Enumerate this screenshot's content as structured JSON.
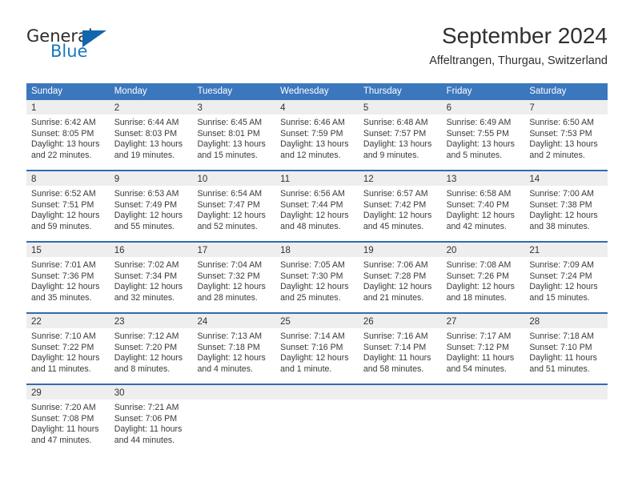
{
  "brand": {
    "name_top": "General",
    "name_bottom": "Blue",
    "color_top": "#2b2b2b",
    "color_bottom": "#1878be",
    "triangle_color": "#1266ab"
  },
  "header": {
    "title": "September 2024",
    "subtitle": "Affeltrangen, Thurgau, Switzerland"
  },
  "theme": {
    "header_blue": "#3b77bd",
    "separator_blue": "#2f6cb3",
    "day_band_gray": "#eeeeee",
    "text_color": "#333333"
  },
  "weekdays": [
    "Sunday",
    "Monday",
    "Tuesday",
    "Wednesday",
    "Thursday",
    "Friday",
    "Saturday"
  ],
  "weeks": [
    [
      {
        "day": "1",
        "sunrise": "Sunrise: 6:42 AM",
        "sunset": "Sunset: 8:05 PM",
        "daylight1": "Daylight: 13 hours",
        "daylight2": "and 22 minutes."
      },
      {
        "day": "2",
        "sunrise": "Sunrise: 6:44 AM",
        "sunset": "Sunset: 8:03 PM",
        "daylight1": "Daylight: 13 hours",
        "daylight2": "and 19 minutes."
      },
      {
        "day": "3",
        "sunrise": "Sunrise: 6:45 AM",
        "sunset": "Sunset: 8:01 PM",
        "daylight1": "Daylight: 13 hours",
        "daylight2": "and 15 minutes."
      },
      {
        "day": "4",
        "sunrise": "Sunrise: 6:46 AM",
        "sunset": "Sunset: 7:59 PM",
        "daylight1": "Daylight: 13 hours",
        "daylight2": "and 12 minutes."
      },
      {
        "day": "5",
        "sunrise": "Sunrise: 6:48 AM",
        "sunset": "Sunset: 7:57 PM",
        "daylight1": "Daylight: 13 hours",
        "daylight2": "and 9 minutes."
      },
      {
        "day": "6",
        "sunrise": "Sunrise: 6:49 AM",
        "sunset": "Sunset: 7:55 PM",
        "daylight1": "Daylight: 13 hours",
        "daylight2": "and 5 minutes."
      },
      {
        "day": "7",
        "sunrise": "Sunrise: 6:50 AM",
        "sunset": "Sunset: 7:53 PM",
        "daylight1": "Daylight: 13 hours",
        "daylight2": "and 2 minutes."
      }
    ],
    [
      {
        "day": "8",
        "sunrise": "Sunrise: 6:52 AM",
        "sunset": "Sunset: 7:51 PM",
        "daylight1": "Daylight: 12 hours",
        "daylight2": "and 59 minutes."
      },
      {
        "day": "9",
        "sunrise": "Sunrise: 6:53 AM",
        "sunset": "Sunset: 7:49 PM",
        "daylight1": "Daylight: 12 hours",
        "daylight2": "and 55 minutes."
      },
      {
        "day": "10",
        "sunrise": "Sunrise: 6:54 AM",
        "sunset": "Sunset: 7:47 PM",
        "daylight1": "Daylight: 12 hours",
        "daylight2": "and 52 minutes."
      },
      {
        "day": "11",
        "sunrise": "Sunrise: 6:56 AM",
        "sunset": "Sunset: 7:44 PM",
        "daylight1": "Daylight: 12 hours",
        "daylight2": "and 48 minutes."
      },
      {
        "day": "12",
        "sunrise": "Sunrise: 6:57 AM",
        "sunset": "Sunset: 7:42 PM",
        "daylight1": "Daylight: 12 hours",
        "daylight2": "and 45 minutes."
      },
      {
        "day": "13",
        "sunrise": "Sunrise: 6:58 AM",
        "sunset": "Sunset: 7:40 PM",
        "daylight1": "Daylight: 12 hours",
        "daylight2": "and 42 minutes."
      },
      {
        "day": "14",
        "sunrise": "Sunrise: 7:00 AM",
        "sunset": "Sunset: 7:38 PM",
        "daylight1": "Daylight: 12 hours",
        "daylight2": "and 38 minutes."
      }
    ],
    [
      {
        "day": "15",
        "sunrise": "Sunrise: 7:01 AM",
        "sunset": "Sunset: 7:36 PM",
        "daylight1": "Daylight: 12 hours",
        "daylight2": "and 35 minutes."
      },
      {
        "day": "16",
        "sunrise": "Sunrise: 7:02 AM",
        "sunset": "Sunset: 7:34 PM",
        "daylight1": "Daylight: 12 hours",
        "daylight2": "and 32 minutes."
      },
      {
        "day": "17",
        "sunrise": "Sunrise: 7:04 AM",
        "sunset": "Sunset: 7:32 PM",
        "daylight1": "Daylight: 12 hours",
        "daylight2": "and 28 minutes."
      },
      {
        "day": "18",
        "sunrise": "Sunrise: 7:05 AM",
        "sunset": "Sunset: 7:30 PM",
        "daylight1": "Daylight: 12 hours",
        "daylight2": "and 25 minutes."
      },
      {
        "day": "19",
        "sunrise": "Sunrise: 7:06 AM",
        "sunset": "Sunset: 7:28 PM",
        "daylight1": "Daylight: 12 hours",
        "daylight2": "and 21 minutes."
      },
      {
        "day": "20",
        "sunrise": "Sunrise: 7:08 AM",
        "sunset": "Sunset: 7:26 PM",
        "daylight1": "Daylight: 12 hours",
        "daylight2": "and 18 minutes."
      },
      {
        "day": "21",
        "sunrise": "Sunrise: 7:09 AM",
        "sunset": "Sunset: 7:24 PM",
        "daylight1": "Daylight: 12 hours",
        "daylight2": "and 15 minutes."
      }
    ],
    [
      {
        "day": "22",
        "sunrise": "Sunrise: 7:10 AM",
        "sunset": "Sunset: 7:22 PM",
        "daylight1": "Daylight: 12 hours",
        "daylight2": "and 11 minutes."
      },
      {
        "day": "23",
        "sunrise": "Sunrise: 7:12 AM",
        "sunset": "Sunset: 7:20 PM",
        "daylight1": "Daylight: 12 hours",
        "daylight2": "and 8 minutes."
      },
      {
        "day": "24",
        "sunrise": "Sunrise: 7:13 AM",
        "sunset": "Sunset: 7:18 PM",
        "daylight1": "Daylight: 12 hours",
        "daylight2": "and 4 minutes."
      },
      {
        "day": "25",
        "sunrise": "Sunrise: 7:14 AM",
        "sunset": "Sunset: 7:16 PM",
        "daylight1": "Daylight: 12 hours",
        "daylight2": "and 1 minute."
      },
      {
        "day": "26",
        "sunrise": "Sunrise: 7:16 AM",
        "sunset": "Sunset: 7:14 PM",
        "daylight1": "Daylight: 11 hours",
        "daylight2": "and 58 minutes."
      },
      {
        "day": "27",
        "sunrise": "Sunrise: 7:17 AM",
        "sunset": "Sunset: 7:12 PM",
        "daylight1": "Daylight: 11 hours",
        "daylight2": "and 54 minutes."
      },
      {
        "day": "28",
        "sunrise": "Sunrise: 7:18 AM",
        "sunset": "Sunset: 7:10 PM",
        "daylight1": "Daylight: 11 hours",
        "daylight2": "and 51 minutes."
      }
    ],
    [
      {
        "day": "29",
        "sunrise": "Sunrise: 7:20 AM",
        "sunset": "Sunset: 7:08 PM",
        "daylight1": "Daylight: 11 hours",
        "daylight2": "and 47 minutes."
      },
      {
        "day": "30",
        "sunrise": "Sunrise: 7:21 AM",
        "sunset": "Sunset: 7:06 PM",
        "daylight1": "Daylight: 11 hours",
        "daylight2": "and 44 minutes."
      },
      {
        "day": "",
        "sunrise": "",
        "sunset": "",
        "daylight1": "",
        "daylight2": ""
      },
      {
        "day": "",
        "sunrise": "",
        "sunset": "",
        "daylight1": "",
        "daylight2": ""
      },
      {
        "day": "",
        "sunrise": "",
        "sunset": "",
        "daylight1": "",
        "daylight2": ""
      },
      {
        "day": "",
        "sunrise": "",
        "sunset": "",
        "daylight1": "",
        "daylight2": ""
      },
      {
        "day": "",
        "sunrise": "",
        "sunset": "",
        "daylight1": "",
        "daylight2": ""
      }
    ]
  ]
}
